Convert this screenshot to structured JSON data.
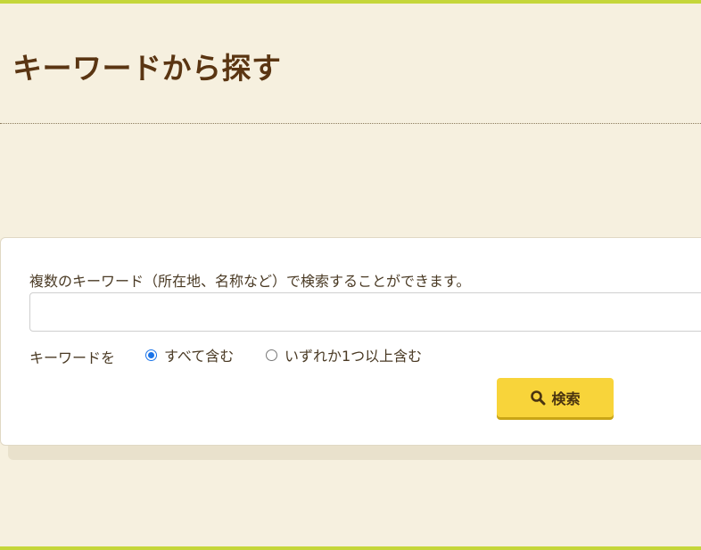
{
  "header": {
    "title": "キーワードから探す"
  },
  "search": {
    "description": "複数のキーワード（所在地、名称など）で検索することができます。",
    "input_value": "",
    "input_placeholder": "",
    "mode_label": "キーワードを",
    "options": [
      {
        "label": "すべて含む",
        "selected": true
      },
      {
        "label": "いずれか1つ以上含む",
        "selected": false
      }
    ],
    "button_label": "検索",
    "button_icon": "search-icon"
  },
  "colors": {
    "accent_line": "#c5d63a",
    "title": "#5a3512",
    "button": "#f8d43a",
    "radio_selected": "#1a73e8"
  }
}
